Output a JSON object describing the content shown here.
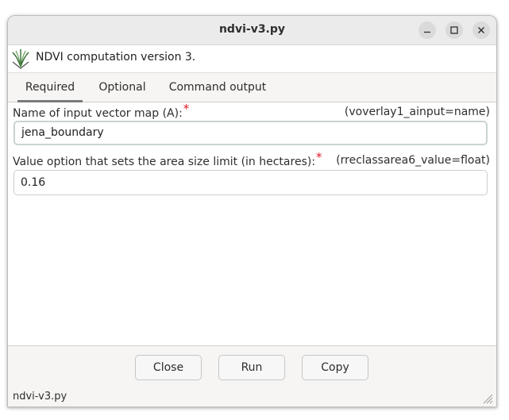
{
  "window": {
    "title": "ndvi-v3.py",
    "controls": {
      "minimize_icon": "minimize-icon",
      "maximize_icon": "maximize-icon",
      "close_icon": "close-icon"
    }
  },
  "header": {
    "icon": "grass-icon",
    "description": "NDVI computation version 3."
  },
  "tabs": [
    {
      "label": "Required",
      "active": true
    },
    {
      "label": "Optional",
      "active": false
    },
    {
      "label": "Command output",
      "active": false
    }
  ],
  "fields": [
    {
      "label": "Name of input vector map (A):",
      "required_mark": "*",
      "param_hint": "(voverlay1_ainput=name)",
      "value": "jena_boundary"
    },
    {
      "label": "Value option that sets the area size limit (in hectares):",
      "required_mark": "*",
      "param_hint": "(rreclassarea6_value=float)",
      "value": "0.16"
    }
  ],
  "buttons": {
    "close_label": "Close",
    "run_label": "Run",
    "copy_label": "Copy"
  },
  "statusbar": {
    "text": "ndvi-v3.py"
  },
  "colors": {
    "required_mark": "#e01b24",
    "active_tab_underline": "#7a7a7a",
    "grass_icon": "#2f6b2f"
  }
}
